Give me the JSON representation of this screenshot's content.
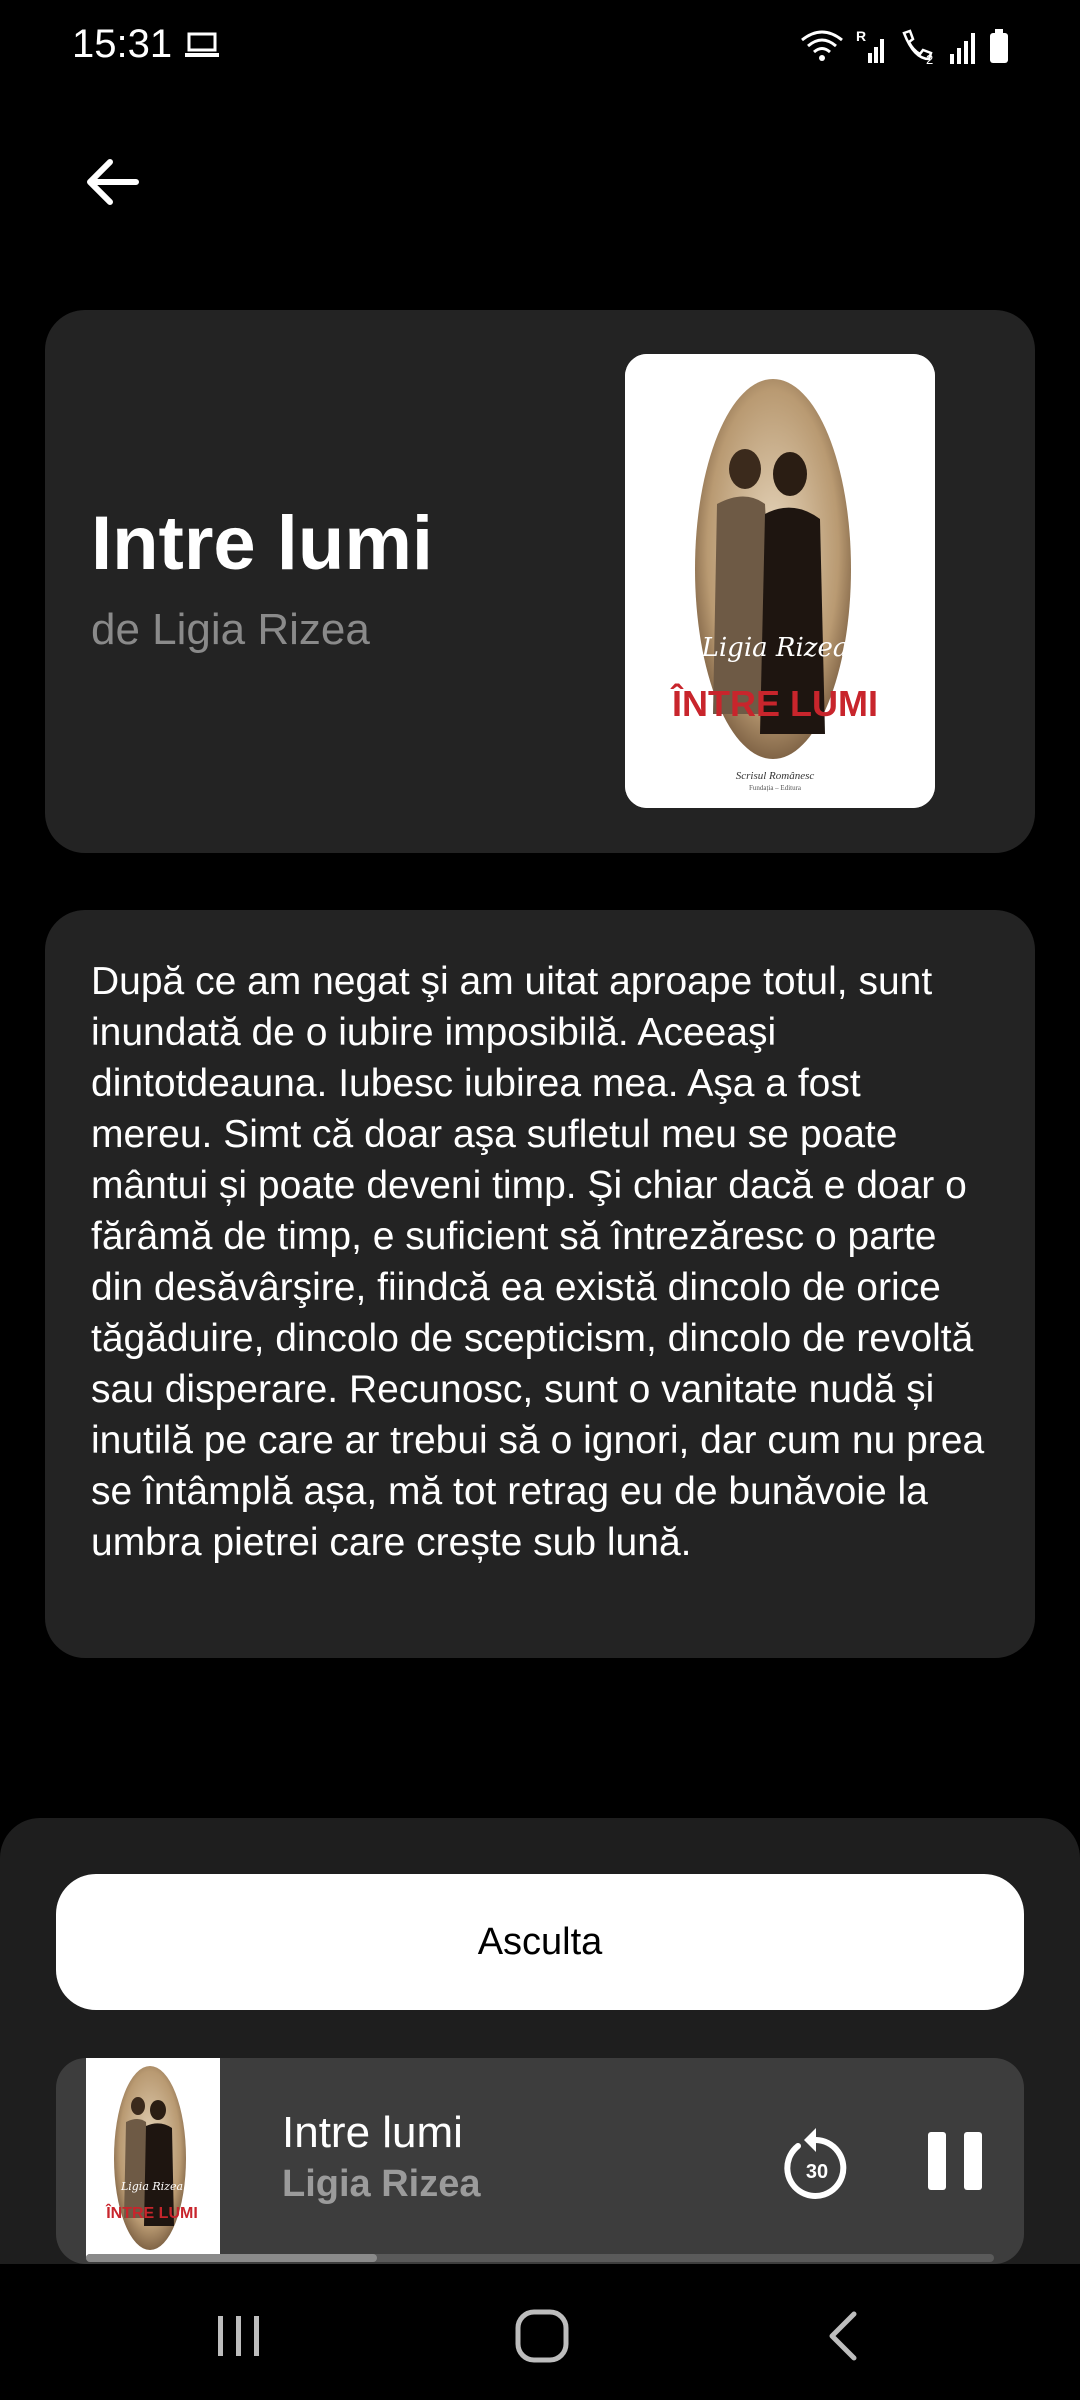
{
  "status_bar": {
    "time": "15:31",
    "icons": [
      "laptop-icon",
      "wifi-icon",
      "signal-roaming-icon",
      "wifi-calling-icon",
      "signal-icon",
      "battery-icon"
    ],
    "roaming_label": "R",
    "sim_label": "2"
  },
  "back_icon": "arrow-left-icon",
  "book": {
    "title": "Intre lumi",
    "author": "de Ligia Rizea",
    "cover": {
      "author_script": "Ligia Rizea",
      "title": "ÎNTRE LUMI",
      "publisher": "Scrisul Românesc",
      "publisher_sub": "Fundația – Editura"
    },
    "description": "După ce am negat şi am uitat aproape totul, sunt inundată de o iubire imposibilă. Aceeaşi dintotdeauna. Iubesc iubirea mea. Aşa a fost mereu. Simt că doar aşa sufletul meu se poate mântui și poate deveni timp. Şi chiar dacă e doar o fărâmă de timp, e suficient să întrezăresc o parte din desăvârşire, fiindcă ea există dincolo de orice tăgăduire, dincolo de scepticism, dincolo de revoltă sau disperare. Recunosc, sunt o vanitate nudă și inutilă pe care ar trebui să o ignori, dar cum nu prea se întâmplă așa, mă tot retrag eu de bunăvoie la umbra pietrei care crește sub lună."
  },
  "actions": {
    "listen_label": "Asculta"
  },
  "player": {
    "title": "Intre lumi",
    "author": "Ligia Rizea",
    "replay_seconds": "30",
    "replay_icon": "replay-30-icon",
    "pause_icon": "pause-icon",
    "progress": 0.32
  },
  "nav": {
    "icons": [
      "recent-apps-icon",
      "home-icon",
      "back-icon"
    ]
  },
  "colors": {
    "background": "#000000",
    "card": "#232323",
    "sheet": "#1e1e1e",
    "player": "#3d3d3d",
    "muted_text": "#8a8a8a",
    "cover_red": "#c8252c"
  }
}
